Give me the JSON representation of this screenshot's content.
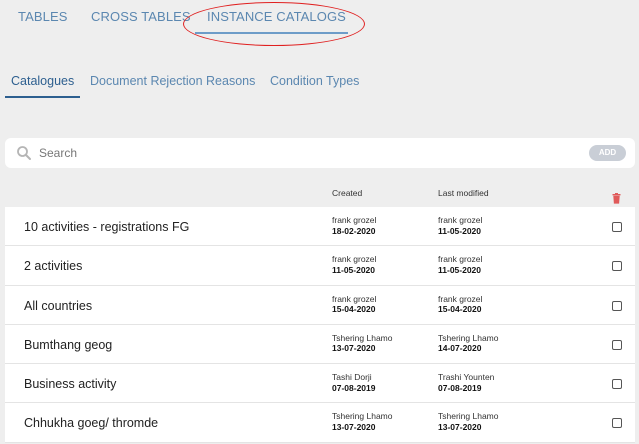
{
  "top_tabs": [
    "TABLES",
    "CROSS TABLES",
    "INSTANCE CATALOGS"
  ],
  "sub_tabs": [
    "Catalogues",
    "Document Rejection Reasons",
    "Condition Types"
  ],
  "search": {
    "placeholder": "Search",
    "add_label": "ADD"
  },
  "columns": {
    "created": "Created",
    "modified": "Last modified"
  },
  "rows": [
    {
      "name": "10 activities - registrations FG",
      "created_by": "frank grozel",
      "created_on": "18-02-2020",
      "modified_by": "frank grozel",
      "modified_on": "11-05-2020"
    },
    {
      "name": "2 activities",
      "created_by": "frank grozel",
      "created_on": "11-05-2020",
      "modified_by": "frank grozel",
      "modified_on": "11-05-2020"
    },
    {
      "name": "All countries",
      "created_by": "frank grozel",
      "created_on": "15-04-2020",
      "modified_by": "frank grozel",
      "modified_on": "15-04-2020"
    },
    {
      "name": "Bumthang geog",
      "created_by": "Tshering Lhamo",
      "created_on": "13-07-2020",
      "modified_by": "Tshering Lhamo",
      "modified_on": "14-07-2020"
    },
    {
      "name": "Business activity",
      "created_by": "Tashi Dorji",
      "created_on": "07-08-2019",
      "modified_by": "Trashi Younten",
      "modified_on": "07-08-2019"
    },
    {
      "name": "Chhukha goeg/ thromde",
      "created_by": "Tshering Lhamo",
      "created_on": "13-07-2020",
      "modified_by": "Tshering Lhamo",
      "modified_on": "13-07-2020"
    }
  ],
  "colors": {
    "accent": "#5b87b0",
    "active_sub": "#2d5f8f",
    "highlight_ring": "#e02020",
    "trash": "#e05a5a"
  }
}
